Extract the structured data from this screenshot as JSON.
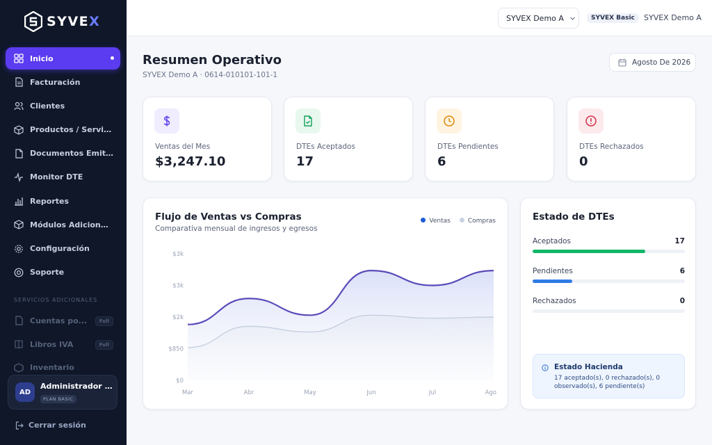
{
  "brand": {
    "name": "SYVE",
    "name_accent": "X"
  },
  "sidebar": {
    "items": [
      {
        "label": "Inicio",
        "icon": "grid-icon"
      },
      {
        "label": "Facturación",
        "icon": "document-icon"
      },
      {
        "label": "Clientes",
        "icon": "users-icon"
      },
      {
        "label": "Productos / Servicios",
        "icon": "box-icon"
      },
      {
        "label": "Documentos Emitidos",
        "icon": "files-icon"
      },
      {
        "label": "Monitor DTE",
        "icon": "pulse-icon"
      },
      {
        "label": "Reportes",
        "icon": "bar-chart-icon"
      },
      {
        "label": "Módulos Adicionales",
        "icon": "cube-icon"
      },
      {
        "label": "Configuración",
        "icon": "gear-icon"
      },
      {
        "label": "Soporte",
        "icon": "help-icon"
      }
    ],
    "section_label": "SERVICIOS ADICIONALES",
    "addons": [
      {
        "label": "Cuentas po...",
        "badge": "Full"
      },
      {
        "label": "Libros IVA",
        "badge": "Full"
      },
      {
        "label": "Inventario",
        "badge": "Full"
      }
    ],
    "user": {
      "initials": "AD",
      "name": "Administrador D...",
      "plan": "PLAN BASIC"
    },
    "logout_label": "Cerrar sesión"
  },
  "topbar": {
    "company": "SYVEX Demo A",
    "plan_chip": "SYVEX Basic",
    "user": "SYVEX Demo A"
  },
  "header": {
    "title": "Resumen Operativo",
    "subtitle": "SYVEX Demo A · 0614-010101-101-1",
    "date_label": "Agosto De 2026"
  },
  "stats": [
    {
      "label": "Ventas del Mes",
      "value": "$3,247.10",
      "icon": "dollar-icon",
      "bg": "#efedff",
      "fg": "#5b3cf0"
    },
    {
      "label": "DTEs Aceptados",
      "value": "17",
      "icon": "file-check-icon",
      "bg": "#e8f8ef",
      "fg": "#13a05a"
    },
    {
      "label": "DTEs Pendientes",
      "value": "6",
      "icon": "clock-icon",
      "bg": "#fff3e2",
      "fg": "#d98a0a"
    },
    {
      "label": "DTEs Rechazados",
      "value": "0",
      "icon": "alert-icon",
      "bg": "#fdeaec",
      "fg": "#d3304a"
    }
  ],
  "chart_card": {
    "title": "Flujo de Ventas vs Compras",
    "subtitle": "Comparativa mensual de ingresos y egresos",
    "legend": [
      {
        "name": "Ventas",
        "color": "#1f5bd6"
      },
      {
        "name": "Compras",
        "color": "#c8d2e3"
      }
    ]
  },
  "chart_data": {
    "type": "area",
    "x": [
      "Mar",
      "Abr",
      "May",
      "Jun",
      "Jul",
      "Ago"
    ],
    "y_ticks": [
      "$0",
      "$850",
      "$2k",
      "$3k",
      "$3k"
    ],
    "y_tick_values": [
      0,
      850,
      1700,
      2550,
      3400
    ],
    "ylim": [
      0,
      3400
    ],
    "series": [
      {
        "name": "Ventas",
        "color": "#5a4bb8",
        "values": [
          1500,
          2200,
          1750,
          2950,
          2550,
          2950
        ]
      },
      {
        "name": "Compras",
        "color": "#c5cfdf",
        "values": [
          880,
          1450,
          1300,
          1750,
          1670,
          1700
        ]
      }
    ],
    "grid": false
  },
  "status_card": {
    "title": "Estado de DTEs",
    "rows": [
      {
        "label": "Aceptados",
        "count": "17",
        "fraction": 0.74,
        "color": "#12b76a"
      },
      {
        "label": "Pendientes",
        "count": "6",
        "fraction": 0.26,
        "color": "#2f7be5"
      },
      {
        "label": "Rechazados",
        "count": "0",
        "fraction": 0,
        "color": "#d3304a"
      }
    ],
    "hacienda_title": "Estado Hacienda",
    "hacienda_text": "17 aceptado(s), 0 rechazado(s), 0 observado(s), 6 pendiente(s)"
  }
}
